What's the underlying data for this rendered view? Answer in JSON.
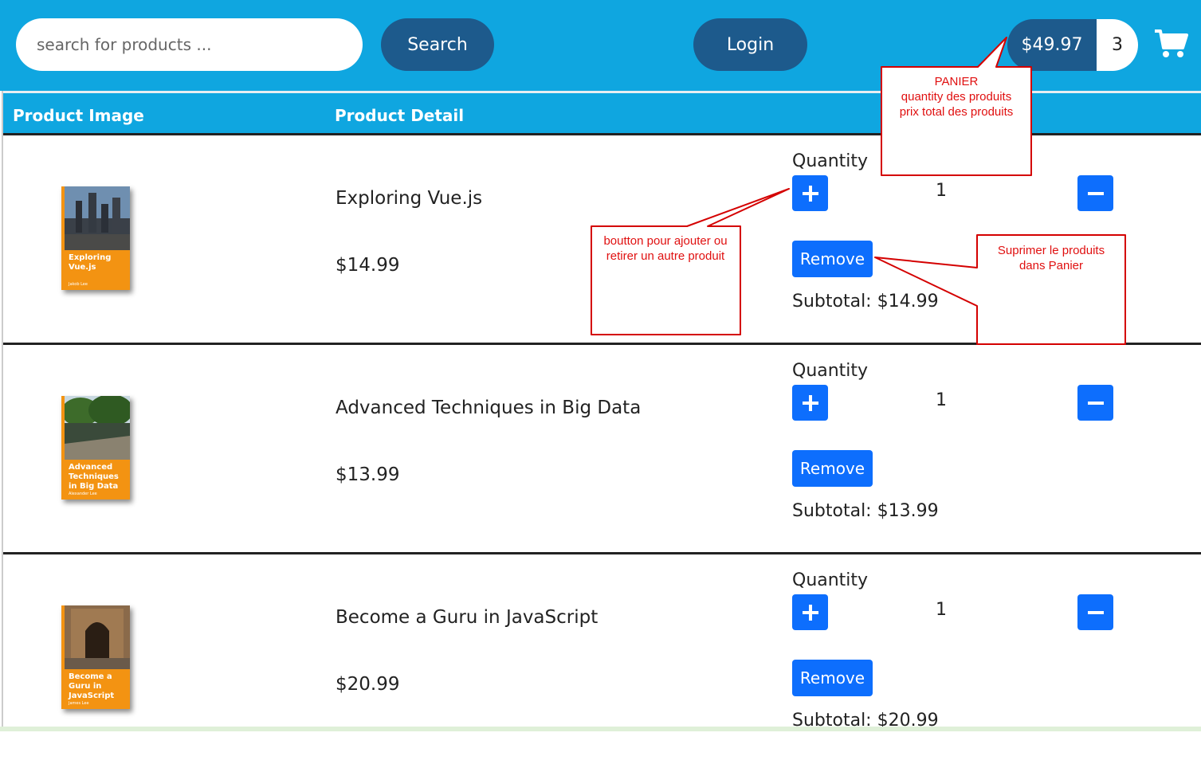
{
  "header": {
    "search_placeholder": "search for products ...",
    "search_label": "Search",
    "login_label": "Login",
    "cart_total": "$49.97",
    "cart_count": "3",
    "cart_icon": "shopping-cart-icon"
  },
  "table": {
    "headers": [
      "Product Image",
      "Product Detail"
    ]
  },
  "products": [
    {
      "name": "Exploring Vue.js",
      "price": "$14.99",
      "cover_title": "Exploring Vue.js",
      "cover_author": "Jakob Lee",
      "qty_label": "Quantity",
      "qty": "1",
      "remove_label": "Remove",
      "subtotal": "Subtotal: $14.99"
    },
    {
      "name": "Advanced Techniques in Big Data",
      "price": "$13.99",
      "cover_title": "Advanced Techniques in Big Data",
      "cover_author": "Alexander Lee",
      "qty_label": "Quantity",
      "qty": "1",
      "remove_label": "Remove",
      "subtotal": "Subtotal: $13.99"
    },
    {
      "name": "Become a Guru in JavaScript",
      "price": "$20.99",
      "cover_title": "Become a Guru in JavaScript",
      "cover_author": "James Lee",
      "qty_label": "Quantity",
      "qty": "1",
      "remove_label": "Remove",
      "subtotal": "Subtotal: $20.99"
    }
  ],
  "annotations": {
    "panier": "PANIER\nquantity des produits\nprix total des produits",
    "bouton": "boutton pour ajouter ou\nretirer un autre produit",
    "supprimer": "Suprimer le produits\ndans Panier"
  },
  "colors": {
    "header_bg": "#0fa6e0",
    "pill_dark": "#1d5a8c",
    "button_blue": "#0d6efd",
    "callout_red": "#e01010",
    "book_orange": "#f39312"
  }
}
